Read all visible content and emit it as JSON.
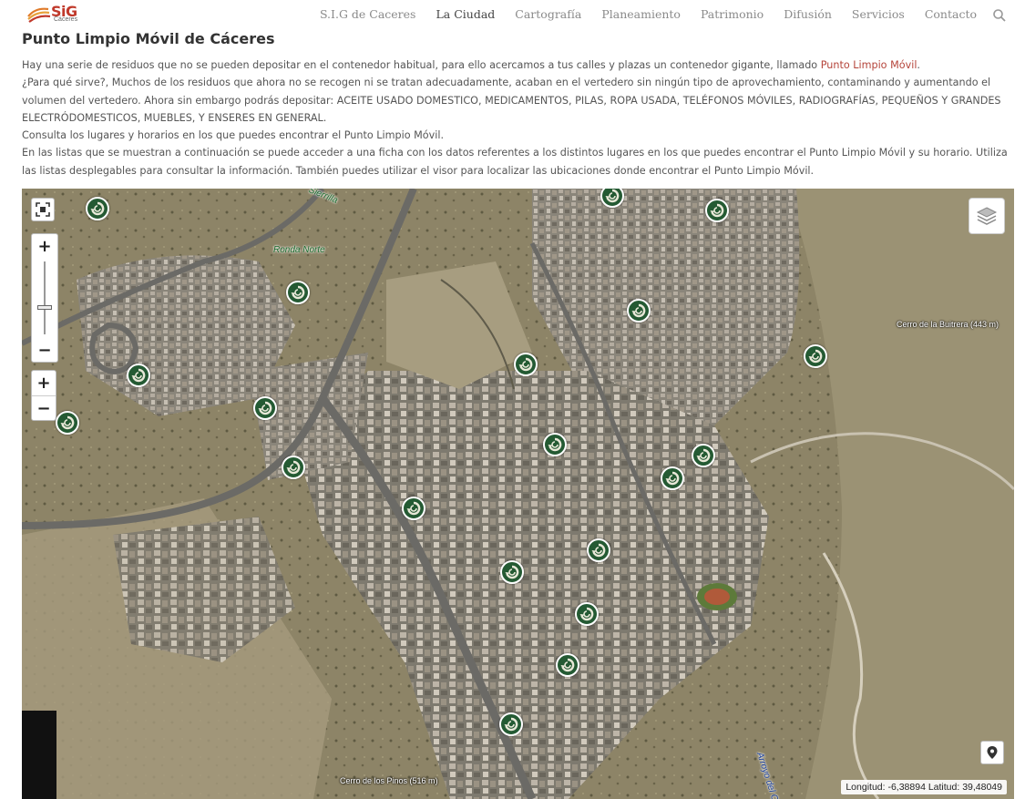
{
  "header": {
    "logo_text": "SiG",
    "logo_sub": "Cáceres",
    "nav": [
      {
        "label": "S.I.G de Caceres",
        "active": false
      },
      {
        "label": "La Ciudad",
        "active": true
      },
      {
        "label": "Cartografía",
        "active": false
      },
      {
        "label": "Planeamiento",
        "active": false
      },
      {
        "label": "Patrimonio",
        "active": false
      },
      {
        "label": "Difusión",
        "active": false
      },
      {
        "label": "Servicios",
        "active": false
      },
      {
        "label": "Contacto",
        "active": false
      }
    ]
  },
  "page": {
    "title": "Punto Limpio Móvil de Cáceres",
    "p1_before": "Hay una serie de residuos que no se pueden depositar en el contenedor habitual, para ello acercamos a tus calles y plazas un contenedor gigante, llamado ",
    "p1_link": "Punto Limpio Móvil",
    "p1_after": ".",
    "p2": "¿Para qué sirve?, Muchos de los residuos que ahora no se recogen ni se tratan adecuadamente, acaban en el vertedero sin ningún tipo de aprovechamiento, contaminando y aumentando el volumen del vertedero. Ahora sin embargo podrás depositar: ACEITE USADO DOMESTICO, MEDICAMENTOS, PILAS, ROPA USADA, TELÉFONOS MÓVILES, RADIOGRAFÍAS, PEQUEÑOS Y GRANDES ELECTRÓDOMESTICOS, MUEBLES, Y ENSERES EN GENERAL.",
    "p3": "Consulta los lugares y horarios en los que puedes encontrar el Punto Limpio Móvil.",
    "p4": "En las listas que se muestran a continuación se puede acceder a una ficha con los datos referentes a los distintos lugares en los que puedes encontrar el Punto Limpio Móvil y su horario. Utiliza las listas desplegables para consultar la información. También puedes utilizar el visor para localizar las ubicaciones donde encontrar el Punto Limpio Móvil."
  },
  "map": {
    "zoom_in": "+",
    "zoom_out": "−",
    "coords": "Longitud: -6,38894 Latitud: 39,48049",
    "labels": {
      "ronda_norte": "Ronda Norte",
      "sierrilla": "Sierrilla",
      "buitrera": "Cerro de la Buitrera (443 m)",
      "pinos": "Cerro de los Pinos (516 m)",
      "arroyo": "Arroyo del C"
    },
    "marker_icon": "recycle-icon",
    "marker_count": 22
  }
}
